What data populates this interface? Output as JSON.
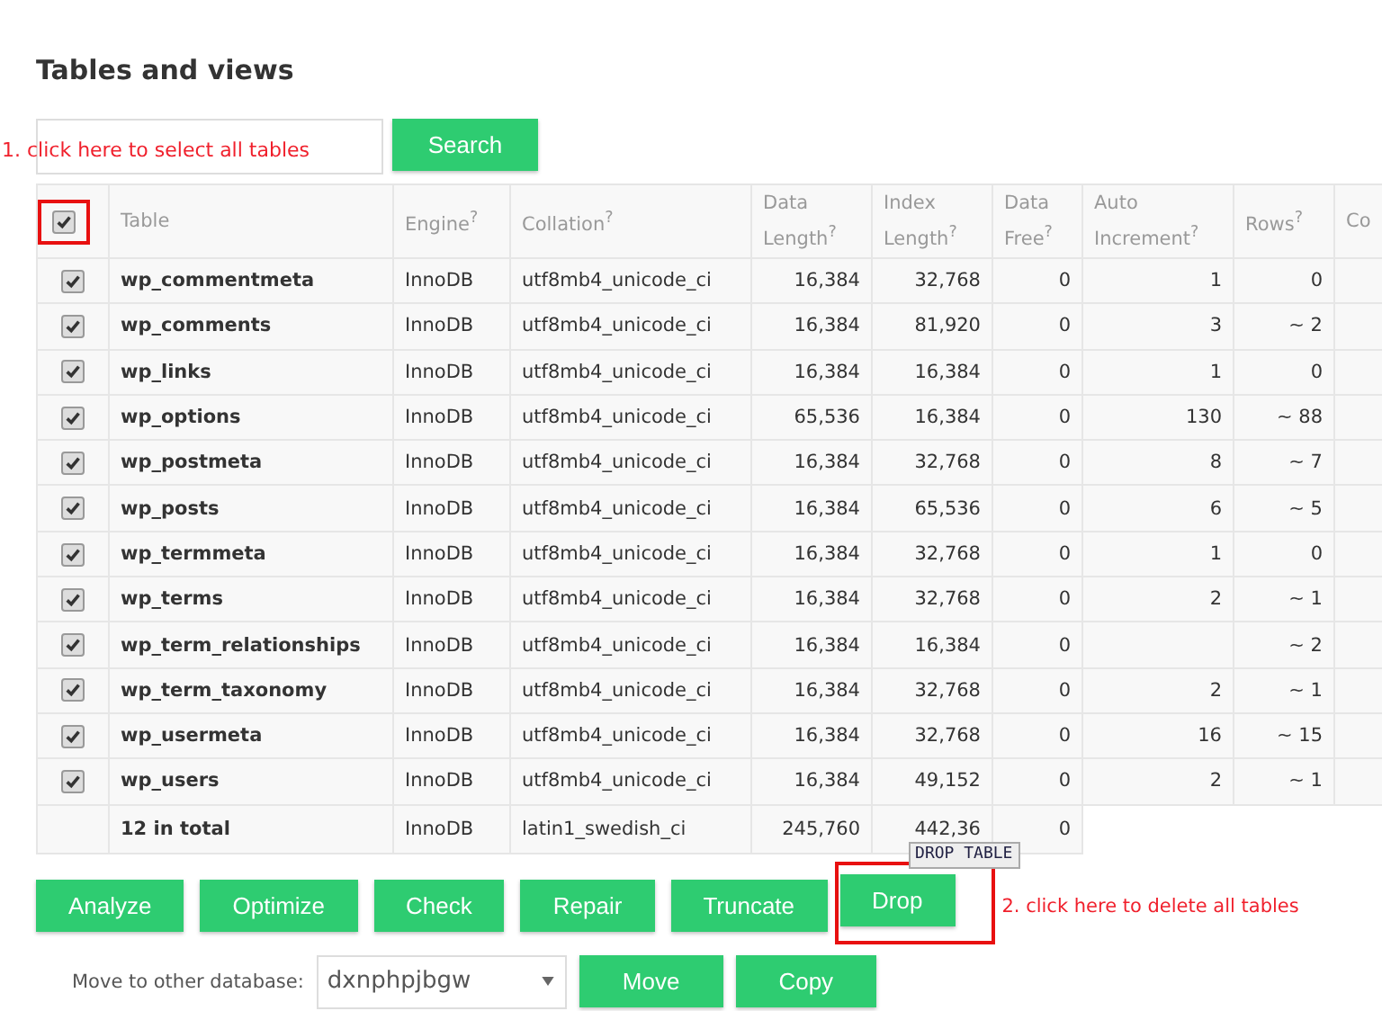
{
  "title": "Tables and views",
  "search": {
    "button": "Search"
  },
  "annotations": [
    "1. click here to select all tables",
    "2. click here to delete all tables"
  ],
  "select_all": {
    "checked": true
  },
  "columns": [
    "Table",
    "Engine$^{?}$",
    "Collation$^{?}$",
    "Data Length$^{?}$",
    "Index Length$^{?}$",
    "Data Free$^{?}$",
    "Auto Increment$^{?}$",
    "Rows$^{?}$",
    "Co"
  ],
  "rows": [
    {
      "checked": true,
      "name": "wp_commentmeta",
      "engine": "InnoDB",
      "collation": "utf8mb4_unicode_ci",
      "data_length": "16,384",
      "index_length": "32,768",
      "data_free": "0",
      "auto_increment": "1",
      "rows": "0"
    },
    {
      "checked": true,
      "name": "wp_comments",
      "engine": "InnoDB",
      "collation": "utf8mb4_unicode_ci",
      "data_length": "16,384",
      "index_length": "81,920",
      "data_free": "0",
      "auto_increment": "3",
      "rows": "~ 2"
    },
    {
      "checked": true,
      "name": "wp_links",
      "engine": "InnoDB",
      "collation": "utf8mb4_unicode_ci",
      "data_length": "16,384",
      "index_length": "16,384",
      "data_free": "0",
      "auto_increment": "1",
      "rows": "0"
    },
    {
      "checked": true,
      "name": "wp_options",
      "engine": "InnoDB",
      "collation": "utf8mb4_unicode_ci",
      "data_length": "65,536",
      "index_length": "16,384",
      "data_free": "0",
      "auto_increment": "130",
      "rows": "~ 88"
    },
    {
      "checked": true,
      "name": "wp_postmeta",
      "engine": "InnoDB",
      "collation": "utf8mb4_unicode_ci",
      "data_length": "16,384",
      "index_length": "32,768",
      "data_free": "0",
      "auto_increment": "8",
      "rows": "~ 7"
    },
    {
      "checked": true,
      "name": "wp_posts",
      "engine": "InnoDB",
      "collation": "utf8mb4_unicode_ci",
      "data_length": "16,384",
      "index_length": "65,536",
      "data_free": "0",
      "auto_increment": "6",
      "rows": "~ 5"
    },
    {
      "checked": true,
      "name": "wp_termmeta",
      "engine": "InnoDB",
      "collation": "utf8mb4_unicode_ci",
      "data_length": "16,384",
      "index_length": "32,768",
      "data_free": "0",
      "auto_increment": "1",
      "rows": "0"
    },
    {
      "checked": true,
      "name": "wp_terms",
      "engine": "InnoDB",
      "collation": "utf8mb4_unicode_ci",
      "data_length": "16,384",
      "index_length": "32,768",
      "data_free": "0",
      "auto_increment": "2",
      "rows": "~ 1"
    },
    {
      "checked": true,
      "name": "wp_term_relationships",
      "engine": "InnoDB",
      "collation": "utf8mb4_unicode_ci",
      "data_length": "16,384",
      "index_length": "16,384",
      "data_free": "0",
      "rows": "~ 2"
    },
    {
      "checked": true,
      "name": "wp_term_taxonomy",
      "engine": "InnoDB",
      "collation": "utf8mb4_unicode_ci",
      "data_length": "16,384",
      "index_length": "32,768",
      "data_free": "0",
      "auto_increment": "2",
      "rows": "~ 1"
    },
    {
      "checked": true,
      "name": "wp_usermeta",
      "engine": "InnoDB",
      "collation": "utf8mb4_unicode_ci",
      "data_length": "16,384",
      "index_length": "32,768",
      "data_free": "0",
      "auto_increment": "16",
      "rows": "~ 15"
    },
    {
      "checked": true,
      "name": "wp_users",
      "engine": "InnoDB",
      "collation": "utf8mb4_unicode_ci",
      "data_length": "16,384",
      "index_length": "49,152",
      "data_free": "0",
      "auto_increment": "2",
      "rows": "~ 1"
    }
  ],
  "total": {
    "name": "12 in total",
    "engine": "InnoDB",
    "collation": "latin1_swedish_ci",
    "data_length": "245,760",
    "index_length": "442,36",
    "data_free": "0"
  },
  "tooltip": "DROP TABLE",
  "actions": [
    {
      "label": "Analyze",
      "highlighted": false
    },
    {
      "label": "Optimize",
      "highlighted": false
    },
    {
      "label": "Check",
      "highlighted": false
    },
    {
      "label": "Repair",
      "highlighted": false
    },
    {
      "label": "Truncate",
      "highlighted": false
    },
    {
      "label": "Drop",
      "highlighted": true
    }
  ],
  "move": {
    "label": "Move to other database:",
    "database": "dxnphpjbgw",
    "buttons": [
      "Move",
      "Copy"
    ]
  }
}
